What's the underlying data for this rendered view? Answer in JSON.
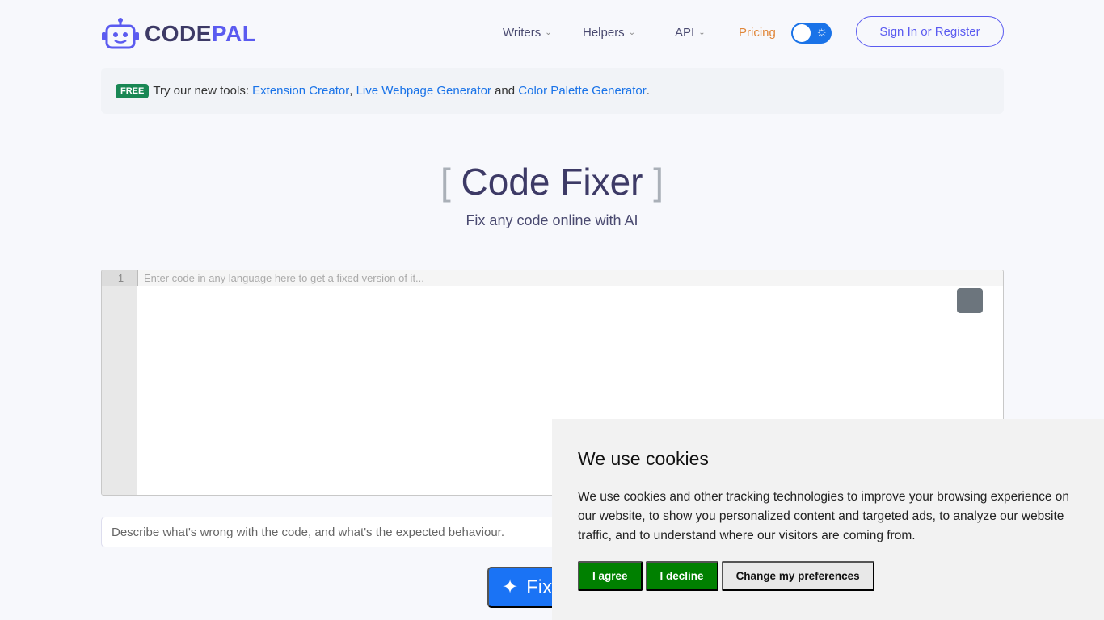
{
  "header": {
    "logo_a": "CODE",
    "logo_b": "PAL",
    "nav": [
      {
        "label": "Writers"
      },
      {
        "label": "Helpers"
      },
      {
        "label": "API"
      },
      {
        "label": "Pricing"
      }
    ],
    "signin": "Sign In or Register",
    "theme_toggle": "on"
  },
  "banner": {
    "badge": "FREE",
    "text": "Try our new tools: ",
    "link1": "Extension Creator",
    "sep1": ", ",
    "link2": "Live Webpage Generator",
    "sep2": " and ",
    "link3": "Color Palette Generator",
    "end": "."
  },
  "hero": {
    "bracket_open": "[",
    "title": "Code Fixer",
    "bracket_close": "]",
    "subtitle": "Fix any code online with AI"
  },
  "editor": {
    "line_number": "1",
    "placeholder": "Enter code in any language here to get a fixed version of it..."
  },
  "description": {
    "placeholder": "Describe what's wrong with the code, and what's the expected behaviour."
  },
  "fix_button": "Fix",
  "cookie": {
    "title": "We use cookies",
    "text": "We use cookies and other tracking technologies to improve your browsing experience on our website, to show you personalized content and targeted ads, to analyze our website traffic, and to understand where our visitors are coming from.",
    "agree": "I agree",
    "decline": "I decline",
    "prefs": "Change my preferences"
  },
  "colors": {
    "brand": "#5b5bf0",
    "pricing": "#e0873a",
    "primary": "#1a73f5",
    "cookie_green": "#008000"
  }
}
